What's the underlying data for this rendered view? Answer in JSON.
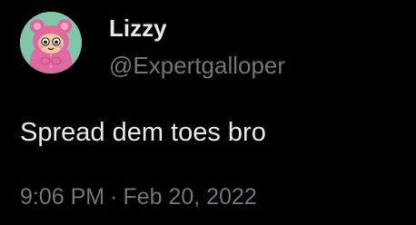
{
  "user": {
    "display_name": "Lizzy",
    "handle": "@Expertgalloper",
    "avatar_icon": "pink-bear-cartoon-avatar"
  },
  "tweet": {
    "text": "Spread dem toes bro",
    "time": "9:06 PM",
    "separator": "·",
    "date": "Feb 20, 2022"
  },
  "colors": {
    "background": "#000000",
    "primary_text": "#e7e9ea",
    "secondary_text": "#71767b",
    "avatar_bg": "#7fc7a8",
    "avatar_character": "#e06aa0"
  }
}
